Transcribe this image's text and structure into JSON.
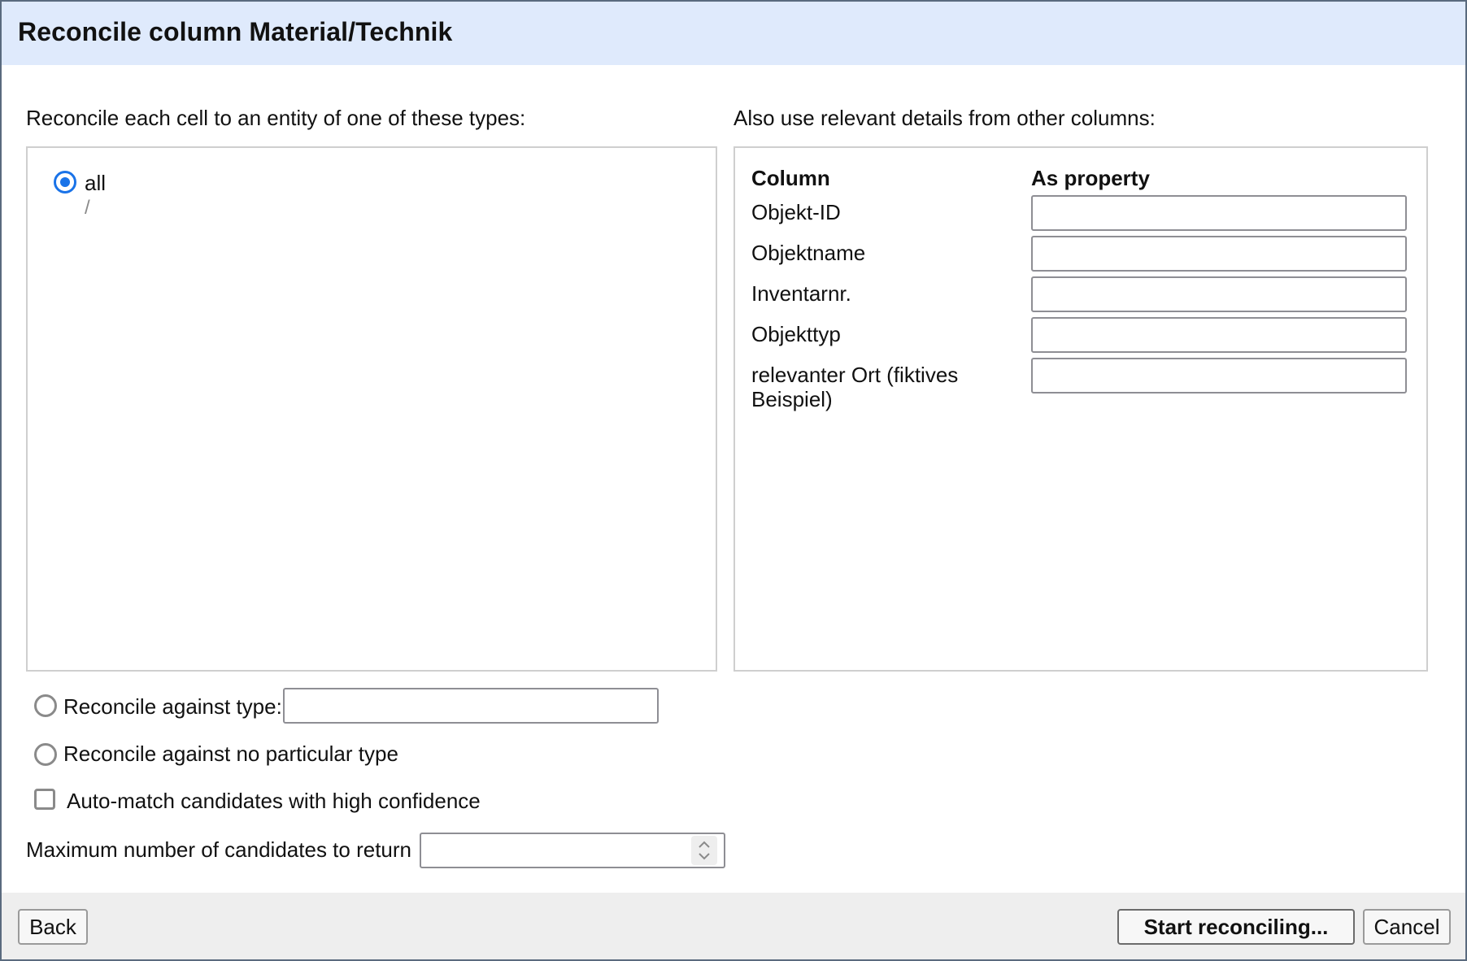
{
  "dialog": {
    "title": "Reconcile column Material/Technik"
  },
  "types_section": {
    "heading": "Reconcile each cell to an entity of one of these types:",
    "options": [
      {
        "label": "all",
        "id": "/",
        "selected": true
      }
    ]
  },
  "details_section": {
    "heading": "Also use relevant details from other columns:",
    "column_header": "Column",
    "property_header": "As property",
    "rows": [
      {
        "column": "Objekt-ID",
        "property": ""
      },
      {
        "column": "Objektname",
        "property": ""
      },
      {
        "column": "Inventarnr.",
        "property": ""
      },
      {
        "column": "Objekttyp",
        "property": ""
      },
      {
        "column": "relevanter Ort (fiktives Beispiel)",
        "property": ""
      }
    ]
  },
  "options": {
    "against_type_label": "Reconcile against type:",
    "against_type_value": "",
    "no_type_label": "Reconcile against no particular type",
    "auto_match_label": "Auto-match candidates with high confidence",
    "auto_match_checked": false,
    "max_candidates_label": "Maximum number of candidates to return",
    "max_candidates_value": ""
  },
  "footer": {
    "back_label": "Back",
    "start_label": "Start reconciling...",
    "cancel_label": "Cancel"
  },
  "icons": {
    "radio_selected_color": "#1a73e8",
    "spinner": "up-down-chevron-icon"
  }
}
